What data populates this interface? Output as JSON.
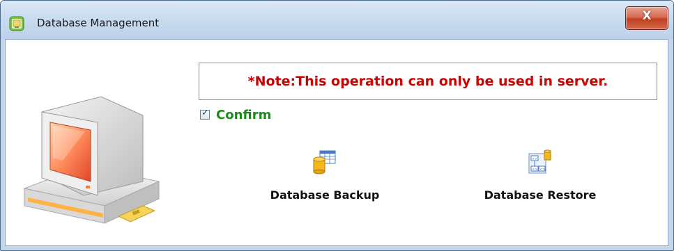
{
  "window": {
    "title": "Database Management",
    "close_symbol": "X",
    "icons": {
      "app": "database-app-icon",
      "close": "close-icon"
    }
  },
  "illustration": {
    "name": "computer-icon"
  },
  "note": {
    "text": "*Note:This operation can only be used in server."
  },
  "confirm": {
    "label": "Confirm",
    "checked": true
  },
  "actions": {
    "backup": {
      "label": "Database Backup",
      "icon": "database-backup-icon"
    },
    "restore": {
      "label": "Database Restore",
      "icon": "database-restore-icon"
    }
  },
  "colors": {
    "note_text": "#cc0000",
    "confirm_text": "#1a8a1a",
    "close_button": "#c2401f",
    "title_bar": "#c9dcef"
  }
}
